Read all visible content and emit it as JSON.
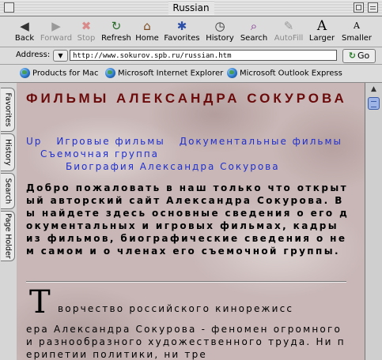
{
  "window": {
    "title": "Russian"
  },
  "toolbar": {
    "buttons": [
      {
        "label": "Back",
        "icon": "back-arrow-icon",
        "glyph": "◀",
        "enabled": true
      },
      {
        "label": "Forward",
        "icon": "forward-arrow-icon",
        "glyph": "▶",
        "enabled": false
      },
      {
        "label": "Stop",
        "icon": "stop-icon",
        "glyph": "✖",
        "enabled": false
      },
      {
        "label": "Refresh",
        "icon": "refresh-icon",
        "glyph": "↻",
        "enabled": true
      },
      {
        "label": "Home",
        "icon": "home-icon",
        "glyph": "⌂",
        "enabled": true
      },
      {
        "label": "Favorites",
        "icon": "favorites-icon",
        "glyph": "✱",
        "enabled": true
      },
      {
        "label": "History",
        "icon": "history-icon",
        "glyph": "◷",
        "enabled": true
      },
      {
        "label": "Search",
        "icon": "search-icon",
        "glyph": "⌕",
        "enabled": true
      },
      {
        "label": "AutoFill",
        "icon": "autofill-icon",
        "glyph": "✎",
        "enabled": false
      },
      {
        "label": "Larger",
        "icon": "text-larger-icon",
        "glyph": "A",
        "enabled": true
      },
      {
        "label": "Smaller",
        "icon": "text-smaller-icon",
        "glyph": "A",
        "enabled": true
      }
    ]
  },
  "address": {
    "label": "Address:",
    "url": "http://www.sokurov.spb.ru/russian.htm",
    "go_label": "Go"
  },
  "favorites_bar": {
    "items": [
      {
        "label": "Products for Mac"
      },
      {
        "label": "Microsoft Internet Explorer"
      },
      {
        "label": "Microsoft Outlook Express"
      }
    ]
  },
  "explorer_tabs": [
    "Favorites",
    "History",
    "Search",
    "Page Holder"
  ],
  "page": {
    "title": "ФИЛЬМЫ АЛЕКСАНДРА СОКУРОВА",
    "nav": {
      "up": "Up",
      "feature_films": "Игровые фильмы",
      "documentaries": "Документальные фильмы",
      "crew": "Съемочная группа",
      "biography": "Биография Александра Сокурова"
    },
    "intro": "Добро пожаловать в наш только что открытый авторский сайт Александра Сокурова. Вы найдете здесь основные сведения о его документальных и игровых фильмах, кадры из фильмов, биографические сведения о нем самом и о членах его съемочной группы.",
    "dropcap": "Т",
    "body_first_line": "ворчество российского кинорежисс",
    "body_rest": "ера Александра Сокурова - феномен огромного и разнообразного художественного труда. Ни перипетии политики, ни тре"
  }
}
